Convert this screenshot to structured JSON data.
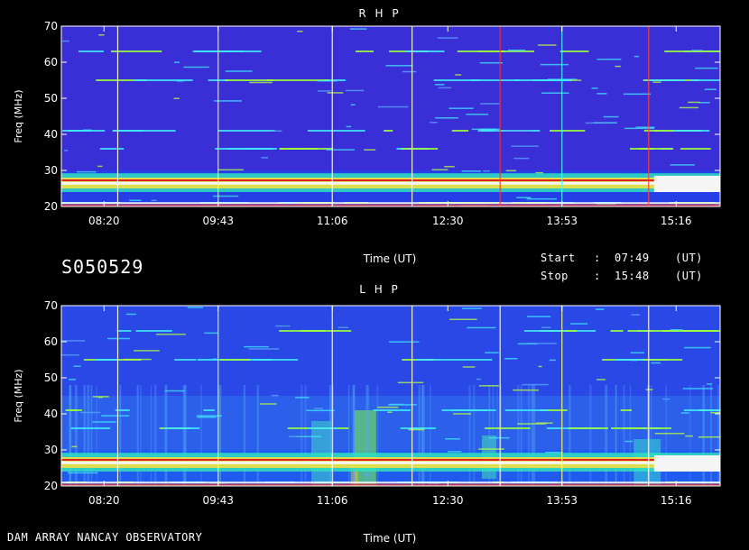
{
  "session_id": "S050529",
  "footer": "DAM ARRAY   NANCAY OBSERVATORY",
  "start": {
    "label": "Start",
    "sep": ":",
    "value": "07:49",
    "unit": "(UT)"
  },
  "stop": {
    "label": "Stop",
    "sep": ":",
    "value": "15:48",
    "unit": "(UT)"
  },
  "colors": {
    "rhp_bg": "#3a2fd6",
    "lhp_bg": "#2a48e6",
    "band": "#f5f5f5"
  },
  "chart_data": [
    {
      "type": "heatmap",
      "title": "R H P",
      "xlabel": "Time (UT)",
      "ylabel": "Freq (MHz)",
      "ylim": [
        20,
        70
      ],
      "yticks": [
        20,
        30,
        40,
        50,
        60,
        70
      ],
      "xlim": [
        "07:49",
        "15:48"
      ],
      "xticks": [
        "08:20",
        "09:43",
        "11:06",
        "12:30",
        "13:53",
        "15:16"
      ],
      "emission_band_mhz": [
        25,
        28
      ],
      "secondary_lines_mhz": [
        21,
        36,
        41,
        55,
        63
      ]
    },
    {
      "type": "heatmap",
      "title": "L H P",
      "xlabel": "Time (UT)",
      "ylabel": "Freq (MHz)",
      "ylim": [
        20,
        70
      ],
      "yticks": [
        20,
        30,
        40,
        50,
        60,
        70
      ],
      "xlim": [
        "07:49",
        "15:48"
      ],
      "xticks": [
        "08:20",
        "09:43",
        "11:06",
        "12:30",
        "13:53",
        "15:16"
      ],
      "emission_band_mhz": [
        25,
        28
      ],
      "secondary_lines_mhz": [
        21,
        36,
        41,
        55,
        63
      ]
    }
  ]
}
